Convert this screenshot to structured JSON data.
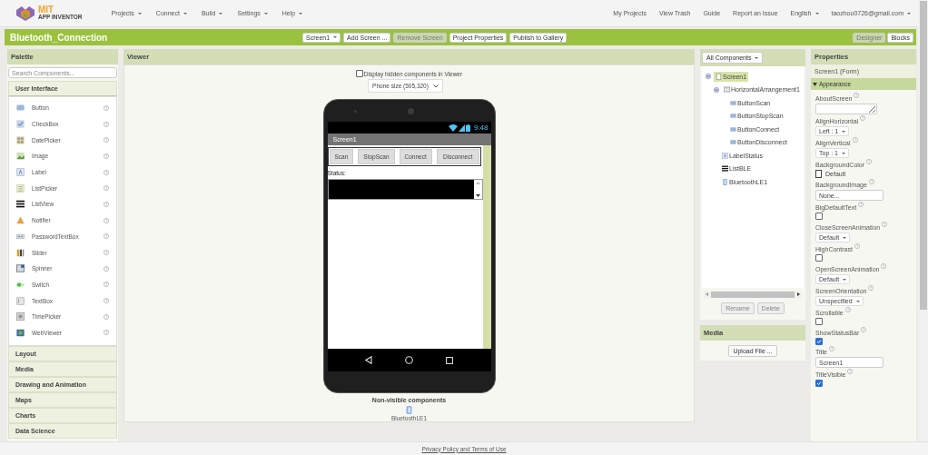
{
  "nav": {
    "logo_title": "MIT",
    "logo_subtitle": "APP INVENTOR",
    "menus": [
      "Projects",
      "Connect",
      "Build",
      "Settings",
      "Help"
    ],
    "links": [
      "My Projects",
      "View Trash",
      "Guide",
      "Report an Issue"
    ],
    "language": "English",
    "account": "taozhou0726@gmail.com"
  },
  "project": {
    "name": "Bluetooth_Connection",
    "buttons": [
      {
        "label": "Screen1",
        "kind": "dropdown",
        "disabled": false
      },
      {
        "label": "Add Screen ...",
        "kind": "button",
        "disabled": false
      },
      {
        "label": "Remove Screen",
        "kind": "button",
        "disabled": true
      },
      {
        "label": "Project Properties",
        "kind": "button",
        "disabled": false
      },
      {
        "label": "Publish to Gallery",
        "kind": "button",
        "disabled": false
      }
    ],
    "views": [
      {
        "label": "Designer",
        "selected": true
      },
      {
        "label": "Blocks",
        "selected": false
      }
    ]
  },
  "palette": {
    "title": "Palette",
    "search": {
      "placeholder": "Search Components..."
    },
    "categories": [
      {
        "label": "User Interface",
        "expanded": true,
        "items": [
          "Button",
          "CheckBox",
          "DatePicker",
          "Image",
          "Label",
          "ListPicker",
          "ListView",
          "Notifier",
          "PasswordTextBox",
          "Slider",
          "Spinner",
          "Switch",
          "TextBox",
          "TimePicker",
          "WebViewer"
        ]
      },
      {
        "label": "Layout",
        "expanded": false
      },
      {
        "label": "Media",
        "expanded": false
      },
      {
        "label": "Drawing and Animation",
        "expanded": false
      },
      {
        "label": "Maps",
        "expanded": false
      },
      {
        "label": "Charts",
        "expanded": false
      },
      {
        "label": "Data Science",
        "expanded": false
      }
    ]
  },
  "viewer": {
    "title": "Viewer",
    "hidden_toggle": {
      "label": "Display hidden components in Viewer",
      "checked": false
    },
    "size": "Phone size (505,320)",
    "phone": {
      "time": "9:48",
      "screen_title": "Screen1",
      "buttons": [
        "Scan",
        "StopScan",
        "Connect",
        "Disconnect"
      ],
      "status_label": "Status:"
    },
    "nonvisible": {
      "title": "Non-visible components",
      "items": [
        "BluetoothLE1"
      ]
    }
  },
  "components": {
    "filter": "All Components",
    "tree": [
      {
        "label": "Screen1",
        "kind": "screen",
        "selected": true,
        "expanded": true,
        "children": [
          {
            "label": "HorizontalArrangement1",
            "kind": "arrangement",
            "selected": false,
            "expanded": true,
            "children": [
              {
                "label": "ButtonScan",
                "kind": "button",
                "selected": false
              },
              {
                "label": "ButtonStopScan",
                "kind": "button",
                "selected": false
              },
              {
                "label": "ButtonConnect",
                "kind": "button",
                "selected": false
              },
              {
                "label": "ButtonDisconnect",
                "kind": "button",
                "selected": false
              }
            ]
          },
          {
            "label": "LabelStatus",
            "kind": "label",
            "selected": false
          },
          {
            "label": "ListBLE",
            "kind": "listview",
            "selected": false
          },
          {
            "label": "BluetoothLE1",
            "kind": "bluetooth",
            "selected": false
          }
        ]
      }
    ],
    "buttons": [
      {
        "label": "Rename",
        "disabled": true
      },
      {
        "label": "Delete",
        "disabled": true
      }
    ]
  },
  "media": {
    "title": "Media",
    "button": "Upload File ..."
  },
  "properties": {
    "title": "Properties",
    "subject": "Screen1 (Form)",
    "section": {
      "label": "Appearance",
      "expanded": true
    },
    "items": [
      {
        "name": "AboutScreen",
        "kind": "textarea"
      },
      {
        "name": "AlignHorizontal",
        "kind": "dropdown",
        "value": "Left : 1"
      },
      {
        "name": "AlignVertical",
        "kind": "dropdown",
        "value": "Top : 1"
      },
      {
        "name": "BackgroundColor",
        "kind": "color",
        "value": "Default"
      },
      {
        "name": "BackgroundImage",
        "kind": "asset",
        "value": "None..."
      },
      {
        "name": "BigDefaultText",
        "kind": "checkbox",
        "checked": false
      },
      {
        "name": "CloseScreenAnimation",
        "kind": "dropdown",
        "value": "Default"
      },
      {
        "name": "HighContrast",
        "kind": "checkbox",
        "checked": false
      },
      {
        "name": "OpenScreenAnimation",
        "kind": "dropdown",
        "value": "Default"
      },
      {
        "name": "ScreenOrientation",
        "kind": "dropdown",
        "value": "Unspecified"
      },
      {
        "name": "Scrollable",
        "kind": "checkbox",
        "checked": false
      },
      {
        "name": "ShowStatusBar",
        "kind": "checkbox",
        "checked": true
      },
      {
        "name": "Title",
        "kind": "text",
        "value": "Screen1"
      },
      {
        "name": "TitleVisible",
        "kind": "checkbox",
        "checked": true
      }
    ]
  },
  "footer": "Privacy Policy and Terms of Use"
}
